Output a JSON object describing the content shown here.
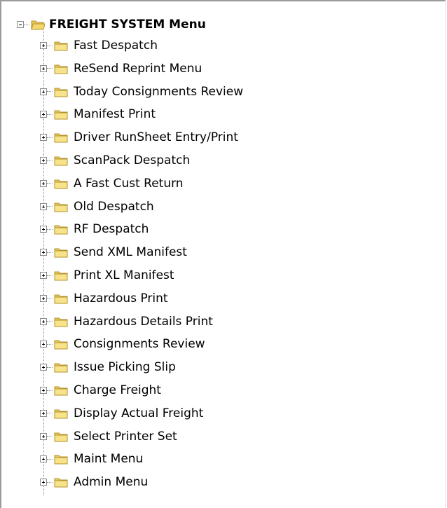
{
  "tree": {
    "root": {
      "label": "FREIGHT SYSTEM Menu",
      "expanded": true
    },
    "items": [
      {
        "label": "Fast Despatch"
      },
      {
        "label": "ReSend Reprint Menu"
      },
      {
        "label": "Today Consignments Review"
      },
      {
        "label": "Manifest Print"
      },
      {
        "label": "Driver RunSheet Entry/Print"
      },
      {
        "label": "ScanPack Despatch"
      },
      {
        "label": "A Fast Cust Return"
      },
      {
        "label": "Old Despatch"
      },
      {
        "label": "RF Despatch"
      },
      {
        "label": "Send XML Manifest"
      },
      {
        "label": "Print XL Manifest"
      },
      {
        "label": "Hazardous Print"
      },
      {
        "label": "Hazardous Details Print"
      },
      {
        "label": "Consignments Review"
      },
      {
        "label": "Issue Picking Slip"
      },
      {
        "label": "Charge Freight"
      },
      {
        "label": "Display Actual Freight"
      },
      {
        "label": "Select Printer Set"
      },
      {
        "label": "Maint Menu"
      },
      {
        "label": "Admin Menu"
      }
    ],
    "icon": "folder-icon",
    "colors": {
      "folder_fill": "#f7e38a",
      "folder_tab": "#e8c95a",
      "folder_outline": "#b3932e",
      "open_folder_fill": "#f3d66e"
    }
  }
}
